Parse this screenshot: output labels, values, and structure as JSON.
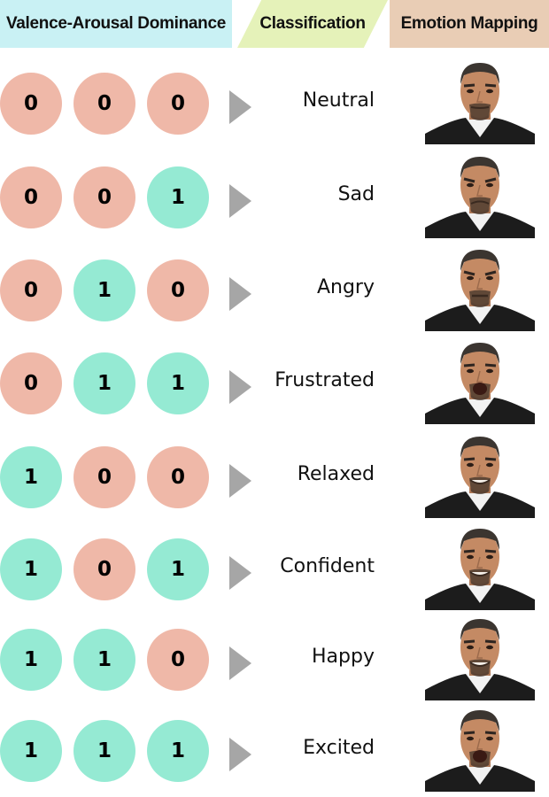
{
  "headers": {
    "vad": "Valence-Arousal Dominance",
    "classification": "Classification",
    "emotion_mapping": "Emotion Mapping"
  },
  "colors": {
    "zero": "#efb8a8",
    "one": "#95ead3",
    "arrow": "#a6a6a6",
    "header_vad": "#c9f1f4",
    "header_classification": "#e5f2b9",
    "header_emotion": "#e9cdb5"
  },
  "rows": [
    {
      "bits": [
        "0",
        "0",
        "0"
      ],
      "label": "Neutral",
      "face": "neutral-face-icon",
      "mouth": "neutral"
    },
    {
      "bits": [
        "0",
        "0",
        "1"
      ],
      "label": "Sad",
      "face": "sad-face-icon",
      "mouth": "sad"
    },
    {
      "bits": [
        "0",
        "1",
        "0"
      ],
      "label": "Angry",
      "face": "angry-face-icon",
      "mouth": "angry"
    },
    {
      "bits": [
        "0",
        "1",
        "1"
      ],
      "label": "Frustrated",
      "face": "frustrated-face-icon",
      "mouth": "open"
    },
    {
      "bits": [
        "1",
        "0",
        "0"
      ],
      "label": "Relaxed",
      "face": "relaxed-face-icon",
      "mouth": "smile"
    },
    {
      "bits": [
        "1",
        "0",
        "1"
      ],
      "label": "Confident",
      "face": "confident-face-icon",
      "mouth": "smile"
    },
    {
      "bits": [
        "1",
        "1",
        "0"
      ],
      "label": "Happy",
      "face": "happy-face-icon",
      "mouth": "smile"
    },
    {
      "bits": [
        "1",
        "1",
        "1"
      ],
      "label": "Excited",
      "face": "excited-face-icon",
      "mouth": "open"
    }
  ]
}
